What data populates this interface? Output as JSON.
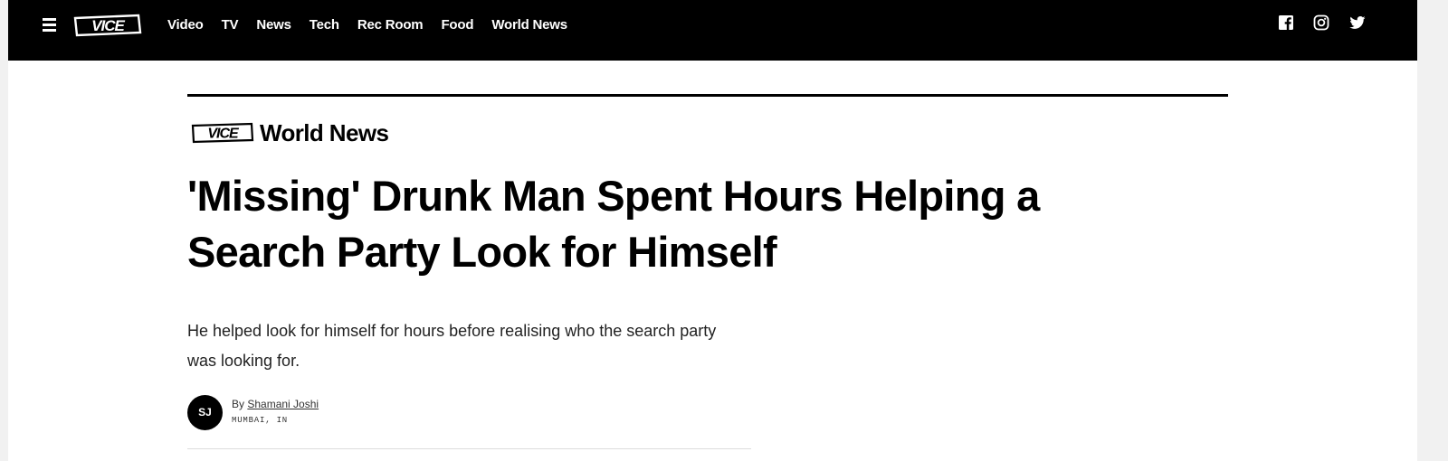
{
  "navbar": {
    "logo_text": "VICE",
    "links": [
      "Video",
      "TV",
      "News",
      "Tech",
      "Rec Room",
      "Food",
      "World News"
    ],
    "social_icons": [
      "facebook-icon",
      "instagram-icon",
      "twitter-icon"
    ]
  },
  "section": {
    "logo_text": "VICE",
    "name": "World News"
  },
  "article": {
    "headline": "'Missing' Drunk Man Spent Hours Helping a Search Party Look for Himself",
    "dek": "He helped look for himself for hours before realising who the search party was looking for.",
    "byline_prefix": "By",
    "author": "Shamani Joshi",
    "author_initials": "SJ",
    "location": "MUMBAI, IN"
  },
  "colors": {
    "navbar_bg": "#000000",
    "page_bg": "#ffffff",
    "text": "#000000"
  }
}
